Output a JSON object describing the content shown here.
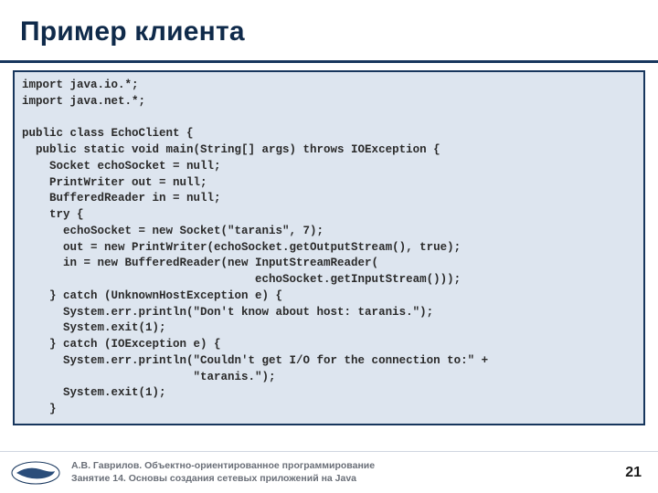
{
  "title": "Пример клиента",
  "code": "import java.io.*;\nimport java.net.*;\n\npublic class EchoClient {\n  public static void main(String[] args) throws IOException {\n    Socket echoSocket = null;\n    PrintWriter out = null;\n    BufferedReader in = null;\n    try {\n      echoSocket = new Socket(\"taranis\", 7);\n      out = new PrintWriter(echoSocket.getOutputStream(), true);\n      in = new BufferedReader(new InputStreamReader(\n                                  echoSocket.getInputStream()));\n    } catch (UnknownHostException e) {\n      System.err.println(\"Don't know about host: taranis.\");\n      System.exit(1);\n    } catch (IOException e) {\n      System.err.println(\"Couldn't get I/O for the connection to:\" +\n                         \"taranis.\");\n      System.exit(1);\n    }",
  "footer": {
    "line1": "А.В. Гаврилов. Объектно-ориентированное программирование",
    "line2": "Занятие 14. Основы создания сетевых приложений на Java"
  },
  "page_number": "21"
}
